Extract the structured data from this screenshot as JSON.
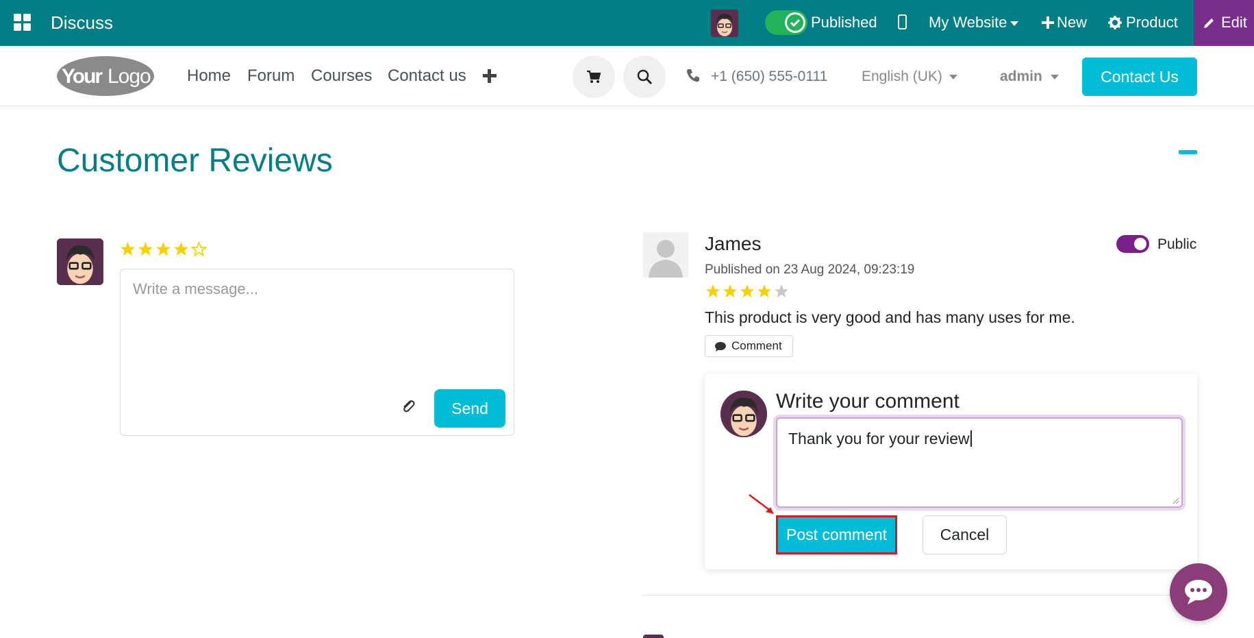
{
  "topbar": {
    "app_name": "Discuss",
    "published_label": "Published",
    "website_label": "My Website",
    "new_label": "New",
    "product_label": "Product",
    "edit_label": "Edit",
    "colors": {
      "bar": "#017e84",
      "edit": "#7a2e8c",
      "toggle": "#21b35a"
    },
    "icons": [
      "apps-grid-icon",
      "user-avatar-icon",
      "check-icon",
      "mobile-icon",
      "plus-icon",
      "gear-icon",
      "pencil-icon"
    ]
  },
  "navbar": {
    "logo_text": "YourLogo",
    "links": [
      "Home",
      "Forum",
      "Courses",
      "Contact us"
    ],
    "phone": "+1 (650) 555-0111",
    "language": "English (UK)",
    "user": "admin",
    "cta_label": "Contact Us",
    "icons": [
      "plus-icon",
      "cart-icon",
      "search-icon",
      "phone-icon",
      "caret-down-icon"
    ]
  },
  "section": {
    "title": "Customer Reviews"
  },
  "composer": {
    "rating": 4,
    "max_rating": 5,
    "placeholder": "Write a message...",
    "send_label": "Send",
    "icons": [
      "star-icon",
      "paperclip-icon"
    ]
  },
  "review": {
    "author": "James",
    "published_on": "Published on 23 Aug 2024, 09:23:19",
    "rating": 4,
    "max_rating": 5,
    "text": "This product is very good and has many uses for me.",
    "comment_label": "Comment",
    "public_label": "Public",
    "public_enabled": true
  },
  "comment_form": {
    "title": "Write your comment",
    "value": "Thank you for your review",
    "post_label": "Post comment",
    "cancel_label": "Cancel"
  },
  "colors": {
    "accent": "#00bcd4",
    "title": "#017e84",
    "star": "#f7d000",
    "public_toggle": "#7a1f8a",
    "highlight": "#d91a1a",
    "chat": "#8a3d78"
  }
}
